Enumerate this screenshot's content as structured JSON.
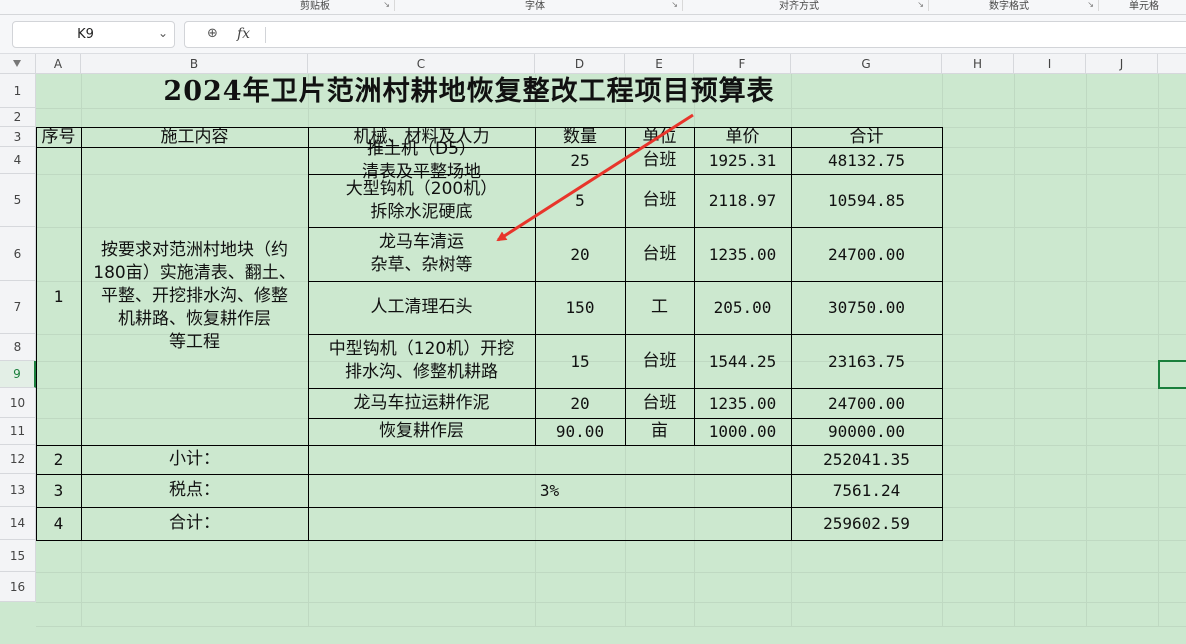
{
  "ribbon": {
    "groups": [
      "剪贴板",
      "字体",
      "对齐方式",
      "数字格式",
      "单元格"
    ]
  },
  "formula_bar": {
    "name_box": "K9",
    "fx_label": "fx",
    "content": ""
  },
  "columns": [
    "A",
    "B",
    "C",
    "D",
    "E",
    "F",
    "G",
    "H",
    "I",
    "J"
  ],
  "rows": [
    "1",
    "2",
    "3",
    "4",
    "5",
    "6",
    "7",
    "8",
    "9",
    "10",
    "11",
    "12",
    "13",
    "14",
    "15",
    "16"
  ],
  "sheet": {
    "title": "2024年卫片范洲村耕地恢复整改工程项目预算表",
    "headers": {
      "seq": "序号",
      "content": "施工内容",
      "machine": "机械、材料及人力",
      "qty": "数量",
      "unit": "单位",
      "price": "单价",
      "total": "合计"
    },
    "seq1": "1",
    "content_text_lines": [
      "按要求对范洲村地块（约",
      "180亩）实施清表、翻土、",
      "平整、开挖排水沟、修整",
      "机耕路、恢复耕作层",
      "等工程"
    ],
    "items": [
      {
        "machine_lines": [
          "推土机（D5）",
          "清表及平整场地"
        ],
        "qty": "25",
        "unit": "台班",
        "price": "1925.31",
        "total": "48132.75"
      },
      {
        "machine_lines": [
          "大型钩机（200机）",
          "拆除水泥硬底"
        ],
        "qty": "5",
        "unit": "台班",
        "price": "2118.97",
        "total": "10594.85"
      },
      {
        "machine_lines": [
          "龙马车清运",
          "杂草、杂树等"
        ],
        "qty": "20",
        "unit": "台班",
        "price": "1235.00",
        "total": "24700.00"
      },
      {
        "machine_lines": [
          "人工清理石头"
        ],
        "qty": "150",
        "unit": "工",
        "price": "205.00",
        "total": "30750.00"
      },
      {
        "machine_lines": [
          "中型钩机（120机）开挖",
          "排水沟、修整机耕路"
        ],
        "qty": "15",
        "unit": "台班",
        "price": "1544.25",
        "total": "23163.75"
      },
      {
        "machine_lines": [
          "龙马车拉运耕作泥"
        ],
        "qty": "20",
        "unit": "台班",
        "price": "1235.00",
        "total": "24700.00"
      },
      {
        "machine_lines": [
          "恢复耕作层"
        ],
        "qty": "90.00",
        "unit": "亩",
        "price": "1000.00",
        "total": "90000.00"
      }
    ],
    "subtotal": {
      "seq": "2",
      "label": "小计：",
      "value": "252041.35"
    },
    "tax": {
      "seq": "3",
      "label": "税点：",
      "rate": "3%",
      "value": "7561.24"
    },
    "grand": {
      "seq": "4",
      "label": "合计：",
      "value": "259602.59"
    }
  },
  "colors": {
    "sheet_bg": "#cce8cf",
    "selection": "#1a7f3c",
    "annotation_arrow": "#e8352b"
  }
}
